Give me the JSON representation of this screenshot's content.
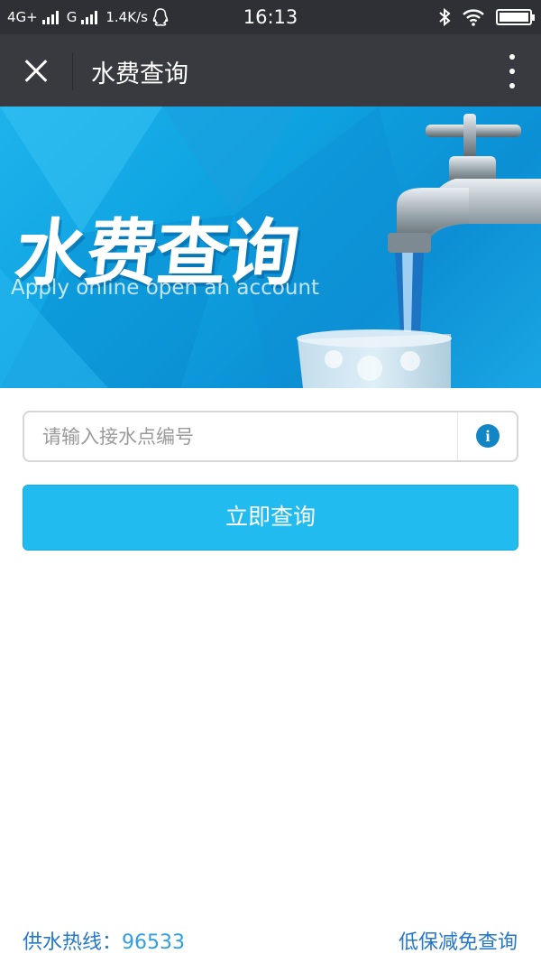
{
  "status_bar": {
    "network_1": "4G+",
    "network_2": "G",
    "speed": "1.4K/s",
    "time": "16:13"
  },
  "title_bar": {
    "title": "水费查询"
  },
  "banner": {
    "title": "水费查询",
    "subtitle": "Apply online open an account"
  },
  "form": {
    "placeholder": "请输入接水点编号",
    "info_glyph": "i",
    "submit_label": "立即查询"
  },
  "footer": {
    "hotline_label": "供水热线：",
    "hotline_number": "96533",
    "relief_link": "低保减免查询"
  },
  "colors": {
    "accent": "#21bbf0",
    "link": "#2577c9",
    "title_bar": "#393a3f"
  }
}
